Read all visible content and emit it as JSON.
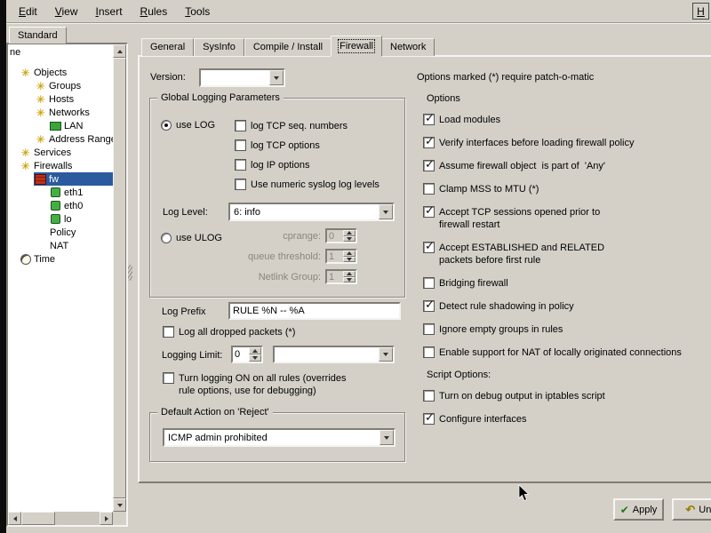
{
  "menubar": {
    "items": [
      "Edit",
      "View",
      "Insert",
      "Rules",
      "Tools"
    ],
    "help_shortcut": "H"
  },
  "sidebar": {
    "library_tab": "Standard",
    "tree_header": "ne",
    "tree": [
      {
        "label": "Objects",
        "level": 0,
        "icon": "lib"
      },
      {
        "label": "Groups",
        "level": 1,
        "icon": "lib"
      },
      {
        "label": "Hosts",
        "level": 1,
        "icon": "lib"
      },
      {
        "label": "Networks",
        "level": 1,
        "icon": "lib"
      },
      {
        "label": "LAN",
        "level": 2,
        "icon": "network"
      },
      {
        "label": "Address Range",
        "level": 1,
        "icon": "lib"
      },
      {
        "label": "Services",
        "level": 0,
        "icon": "lib"
      },
      {
        "label": "Firewalls",
        "level": 0,
        "icon": "lib"
      },
      {
        "label": "fw",
        "level": 1,
        "icon": "firewall",
        "selected": true
      },
      {
        "label": "eth1",
        "level": 2,
        "icon": "iface"
      },
      {
        "label": "eth0",
        "level": 2,
        "icon": "iface"
      },
      {
        "label": "lo",
        "level": 2,
        "icon": "iface"
      },
      {
        "label": "Policy",
        "level": 2,
        "icon": "none"
      },
      {
        "label": "NAT",
        "level": 2,
        "icon": "none"
      },
      {
        "label": "Time",
        "level": 0,
        "icon": "clock"
      }
    ]
  },
  "dialog": {
    "tabs": [
      {
        "label": "General"
      },
      {
        "label": "SysInfo"
      },
      {
        "label": "Compile / Install"
      },
      {
        "label": "Firewall",
        "active": true
      },
      {
        "label": "Network"
      }
    ],
    "version_label": "Version:",
    "version_value": "",
    "patch_note": "Options marked (*) require patch-o-matic",
    "logging": {
      "title": "Global Logging Parameters",
      "use_log_label": "use LOG",
      "use_log_selected": true,
      "flag_checkboxes": [
        {
          "label": "log TCP seq. numbers",
          "checked": false
        },
        {
          "label": "log TCP options",
          "checked": false
        },
        {
          "label": "log IP options",
          "checked": false
        },
        {
          "label": "Use numeric syslog log levels",
          "checked": false
        }
      ],
      "log_level_label": "Log Level:",
      "log_level_value": "6: info",
      "use_ulog_label": "use ULOG",
      "use_ulog_selected": false,
      "ulog_fields": [
        {
          "label": "cprange:",
          "value": "0"
        },
        {
          "label": "queue threshold:",
          "value": "1"
        },
        {
          "label": "Netlink Group:",
          "value": "1"
        }
      ],
      "log_prefix_label": "Log Prefix",
      "log_prefix_value": "RULE %N -- %A",
      "log_dropped": {
        "label": "Log all dropped packets (*)",
        "checked": false
      },
      "logging_limit_label": "Logging Limit:",
      "logging_limit_value": "0",
      "logging_limit_combo_value": "",
      "turn_logging": {
        "label": "Turn logging ON on all rules (overrides\nrule options, use for debugging)",
        "checked": false
      }
    },
    "default_action": {
      "title": "Default Action on 'Reject'",
      "value": "ICMP admin prohibited"
    },
    "options": {
      "title": "Options",
      "items": [
        {
          "label": "Load modules",
          "checked": true
        },
        {
          "label": "Verify interfaces before loading firewall policy",
          "checked": true
        },
        {
          "label": "Assume firewall object  is part of  'Any'",
          "checked": true
        },
        {
          "label": "Clamp MSS to MTU (*)",
          "checked": false
        },
        {
          "label": "Accept TCP sessions opened prior to\nfirewall restart",
          "checked": true
        },
        {
          "label": "Accept ESTABLISHED and RELATED\npackets before first rule",
          "checked": true
        },
        {
          "label": "Bridging firewall",
          "checked": false
        },
        {
          "label": "Detect rule shadowing in policy",
          "checked": true
        },
        {
          "label": "Ignore empty groups in rules",
          "checked": false
        },
        {
          "label": "Enable support for NAT of locally originated connections",
          "checked": false
        }
      ],
      "script_title": "Script Options:",
      "script_items": [
        {
          "label": "Turn on debug output in iptables script",
          "checked": false
        },
        {
          "label": "Configure interfaces",
          "checked": true
        }
      ]
    },
    "buttons": {
      "apply": "Apply",
      "undo": "Undo"
    }
  }
}
